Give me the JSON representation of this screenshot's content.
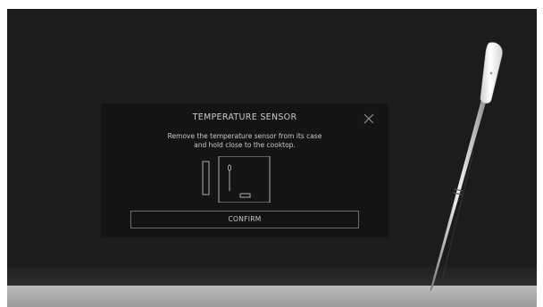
{
  "dialog": {
    "title": "TEMPERATURE SENSOR",
    "instruction_line1": "Remove the temperature sensor from its case",
    "instruction_line2": "and hold close to the cooktop.",
    "confirm_label": "CONFIRM",
    "close_icon": "close-icon",
    "illustration_icon": "sensor-case-illustration"
  },
  "colors": {
    "cooktop": "#1c1c1c",
    "dialog_background": "#141414",
    "text": "#c9c9c9",
    "button_border": "#6e6e6e",
    "counter": "#b0b0b0"
  }
}
